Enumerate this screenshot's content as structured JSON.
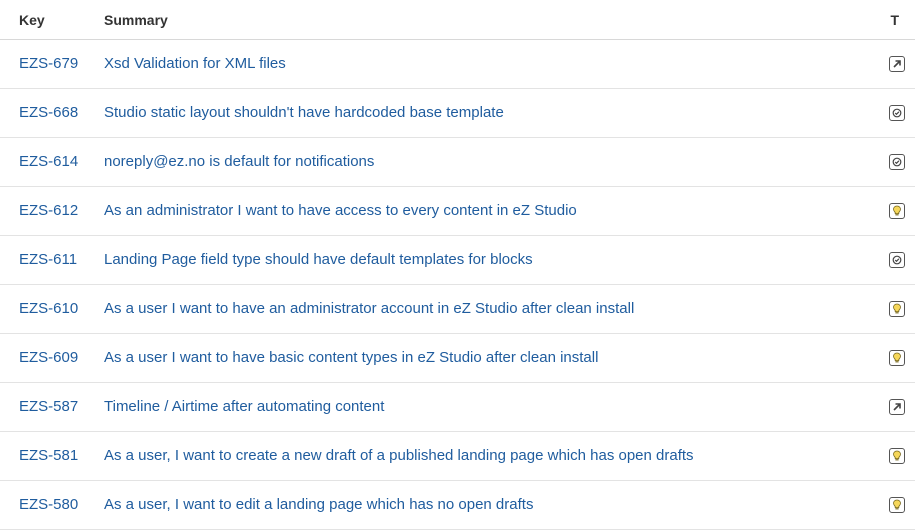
{
  "headers": {
    "key": "Key",
    "summary": "Summary",
    "type": "T"
  },
  "issues": [
    {
      "key": "EZS-679",
      "summary": "Xsd Validation for XML files",
      "type_icon": "improvement-icon"
    },
    {
      "key": "EZS-668",
      "summary": "Studio static layout shouldn't have hardcoded base template",
      "type_icon": "task-icon"
    },
    {
      "key": "EZS-614",
      "summary": "noreply@ez.no is default for notifications",
      "type_icon": "task-icon"
    },
    {
      "key": "EZS-612",
      "summary": "As an administrator I want to have access to every content in eZ Studio",
      "type_icon": "story-icon"
    },
    {
      "key": "EZS-611",
      "summary": "Landing Page field type should have default templates for blocks",
      "type_icon": "task-icon"
    },
    {
      "key": "EZS-610",
      "summary": "As a user I want to have an administrator account in eZ Studio after clean install",
      "type_icon": "story-icon"
    },
    {
      "key": "EZS-609",
      "summary": "As a user I want to have basic content types in eZ Studio after clean install",
      "type_icon": "story-icon"
    },
    {
      "key": "EZS-587",
      "summary": "Timeline / Airtime after automating content",
      "type_icon": "improvement-icon"
    },
    {
      "key": "EZS-581",
      "summary": "As a user, I want to create a new draft of a published landing page which has open drafts",
      "type_icon": "story-icon"
    },
    {
      "key": "EZS-580",
      "summary": "As a user, I want to edit a landing page which has no open drafts",
      "type_icon": "story-icon"
    }
  ]
}
